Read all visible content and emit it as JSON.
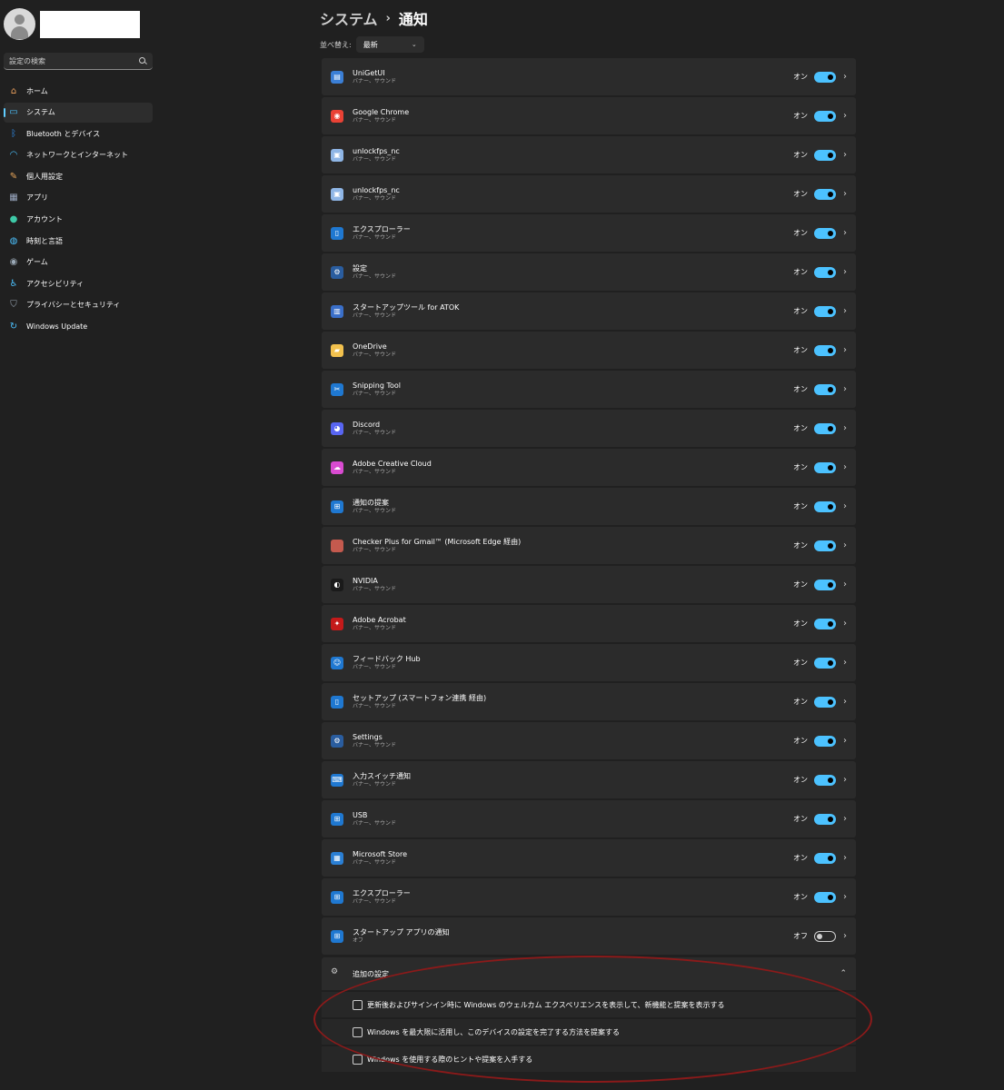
{
  "sidebar": {
    "search_placeholder": "設定の検索",
    "items": [
      {
        "label": "ホーム",
        "icon": "home-icon",
        "glyph": "⌂",
        "color": "#f0a35e",
        "active": false
      },
      {
        "label": "システム",
        "icon": "system-icon",
        "glyph": "▭",
        "color": "#4cc2ff",
        "active": true
      },
      {
        "label": "Bluetooth とデバイス",
        "icon": "bluetooth-icon",
        "glyph": "ᛒ",
        "color": "#2f8ff0",
        "active": false
      },
      {
        "label": "ネットワークとインターネット",
        "icon": "wifi-icon",
        "glyph": "◠",
        "color": "#4cc2ff",
        "active": false
      },
      {
        "label": "個人用設定",
        "icon": "brush-icon",
        "glyph": "✎",
        "color": "#e8a65a",
        "active": false
      },
      {
        "label": "アプリ",
        "icon": "apps-icon",
        "glyph": "▦",
        "color": "#9aa8c0",
        "active": false
      },
      {
        "label": "アカウント",
        "icon": "account-icon",
        "glyph": "●",
        "color": "#3ec9a7",
        "active": false
      },
      {
        "label": "時刻と言語",
        "icon": "globe-icon",
        "glyph": "◍",
        "color": "#4cc2ff",
        "active": false
      },
      {
        "label": "ゲーム",
        "icon": "gamepad-icon",
        "glyph": "◉",
        "color": "#9aa8b5",
        "active": false
      },
      {
        "label": "アクセシビリティ",
        "icon": "accessibility-icon",
        "glyph": "♿",
        "color": "#4cc2ff",
        "active": false
      },
      {
        "label": "プライバシーとセキュリティ",
        "icon": "shield-icon",
        "glyph": "⛉",
        "color": "#9aa8b5",
        "active": false
      },
      {
        "label": "Windows Update",
        "icon": "update-icon",
        "glyph": "↻",
        "color": "#4cc2ff",
        "active": false
      }
    ]
  },
  "header": {
    "parent": "システム",
    "separator": "›",
    "current": "通知"
  },
  "sort": {
    "label": "並べ替え:",
    "value": "最新",
    "chevron": "⌄"
  },
  "apps": [
    {
      "name": "UniGetUI",
      "sub": "バナー、サウンド",
      "state": "オン",
      "on": true,
      "icon": "unigetui-icon",
      "color": "#3b7fd6",
      "glyph": "▤"
    },
    {
      "name": "Google Chrome",
      "sub": "バナー、サウンド",
      "state": "オン",
      "on": true,
      "icon": "chrome-icon",
      "color": "#e94235",
      "glyph": "◉"
    },
    {
      "name": "unlockfps_nc",
      "sub": "バナー、サウンド",
      "state": "オン",
      "on": true,
      "icon": "image-icon",
      "color": "#8fb6e6",
      "glyph": "▣"
    },
    {
      "name": "unlockfps_nc",
      "sub": "バナー、サウンド",
      "state": "オン",
      "on": true,
      "icon": "image-icon",
      "color": "#8fb6e6",
      "glyph": "▣"
    },
    {
      "name": "エクスプローラー",
      "sub": "バナー、サウンド",
      "state": "オン",
      "on": true,
      "icon": "explorer-icon",
      "color": "#1f78d1",
      "glyph": "▯"
    },
    {
      "name": "設定",
      "sub": "バナー、サウンド",
      "state": "オン",
      "on": true,
      "icon": "settings-icon",
      "color": "#2a5d9f",
      "glyph": "⚙"
    },
    {
      "name": "スタートアップツール for ATOK",
      "sub": "バナー、サウンド",
      "state": "オン",
      "on": true,
      "icon": "atok-icon",
      "color": "#3a6fc9",
      "glyph": "▥"
    },
    {
      "name": "OneDrive",
      "sub": "バナー、サウンド",
      "state": "オン",
      "on": true,
      "icon": "onedrive-icon",
      "color": "#f2c14e",
      "glyph": "▰"
    },
    {
      "name": "Snipping Tool",
      "sub": "バナー、サウンド",
      "state": "オン",
      "on": true,
      "icon": "snipping-icon",
      "color": "#1f78d1",
      "glyph": "✂"
    },
    {
      "name": "Discord",
      "sub": "バナー、サウンド",
      "state": "オン",
      "on": true,
      "icon": "discord-icon",
      "color": "#5865f2",
      "glyph": "◕"
    },
    {
      "name": "Adobe Creative Cloud",
      "sub": "バナー、サウンド",
      "state": "オン",
      "on": true,
      "icon": "creative-cloud-icon",
      "color": "#d94bd1",
      "glyph": "☁"
    },
    {
      "name": "通知の提案",
      "sub": "バナー、サウンド",
      "state": "オン",
      "on": true,
      "icon": "windows-icon",
      "color": "#1f78d1",
      "glyph": "⊞"
    },
    {
      "name": "Checker Plus for Gmail™ (Microsoft Edge 経由)",
      "sub": "バナー、サウンド",
      "state": "オン",
      "on": true,
      "icon": "gmail-checker-icon",
      "color": "#c45a4e",
      "glyph": ""
    },
    {
      "name": "NVIDIA",
      "sub": "バナー、サウンド",
      "state": "オン",
      "on": true,
      "icon": "nvidia-icon",
      "color": "#1a1a1a",
      "glyph": "◐"
    },
    {
      "name": "Adobe Acrobat",
      "sub": "バナー、サウンド",
      "state": "オン",
      "on": true,
      "icon": "acrobat-icon",
      "color": "#c41a1a",
      "glyph": "✦"
    },
    {
      "name": "フィードバック Hub",
      "sub": "バナー、サウンド",
      "state": "オン",
      "on": true,
      "icon": "feedback-icon",
      "color": "#1f78d1",
      "glyph": "☺"
    },
    {
      "name": "セットアップ (スマートフォン連携 経由)",
      "sub": "バナー、サウンド",
      "state": "オン",
      "on": true,
      "icon": "phone-link-icon",
      "color": "#1f78d1",
      "glyph": "▯"
    },
    {
      "name": "Settings",
      "sub": "バナー、サウンド",
      "state": "オン",
      "on": true,
      "icon": "settings-icon",
      "color": "#2a5d9f",
      "glyph": "⚙"
    },
    {
      "name": "入力スイッチ通知",
      "sub": "バナー、サウンド",
      "state": "オン",
      "on": true,
      "icon": "input-switch-icon",
      "color": "#1f78d1",
      "glyph": "⌨"
    },
    {
      "name": "USB",
      "sub": "バナー、サウンド",
      "state": "オン",
      "on": true,
      "icon": "windows-icon",
      "color": "#1f78d1",
      "glyph": "⊞"
    },
    {
      "name": "Microsoft Store",
      "sub": "バナー、サウンド",
      "state": "オン",
      "on": true,
      "icon": "store-icon",
      "color": "#2a7fd4",
      "glyph": "▦"
    },
    {
      "name": "エクスプローラー",
      "sub": "バナー、サウンド",
      "state": "オン",
      "on": true,
      "icon": "windows-icon",
      "color": "#1f78d1",
      "glyph": "⊞"
    },
    {
      "name": "スタートアップ アプリの通知",
      "sub": "オフ",
      "state": "オフ",
      "on": false,
      "icon": "windows-icon",
      "color": "#1f78d1",
      "glyph": "⊞"
    }
  ],
  "extra": {
    "label": "追加の設定",
    "icon": "gears-icon",
    "glyph": "⚙",
    "chevron": "⌃",
    "options": [
      {
        "label": "更新後およびサインイン時に Windows のウェルカム エクスペリエンスを表示して、新機能と提案を表示する",
        "checked": false
      },
      {
        "label": "Windows を最大限に活用し、このデバイスの設定を完了する方法を提案する",
        "checked": false
      },
      {
        "label": "Windows を使用する際のヒントや提案を入手する",
        "checked": false
      }
    ]
  },
  "colors": {
    "accent": "#4cc2ff",
    "background": "#202020",
    "card": "#2b2b2b",
    "highlight": "#8b1a1a"
  }
}
